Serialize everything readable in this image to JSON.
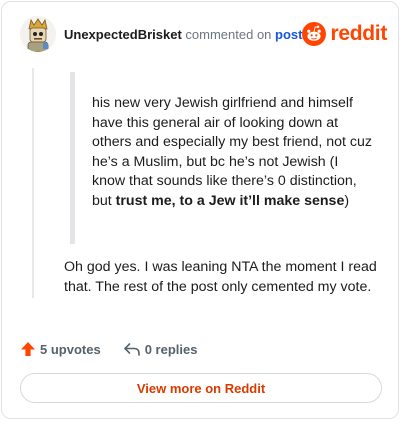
{
  "header": {
    "username": "UnexpectedBrisket",
    "action_text": "commented on",
    "post_link": "post",
    "brand_name": "reddit"
  },
  "comment": {
    "quote_part1": "his new very Jewish girlfriend and himself have this general air of looking down at others and especially my best friend, not cuz he’s a Muslim, but bc he’s not Jewish (I know that sounds like there’s 0 distinction, but ",
    "quote_bold": "trust me, to a Jew it’ll make sense",
    "quote_part3": ")",
    "reply_text": "Oh god yes. I was leaning NTA the moment I read that. The rest of the post only cemented my vote."
  },
  "footer": {
    "upvotes_label": "5 upvotes",
    "replies_label": "0 replies",
    "view_more_label": "View more on Reddit"
  },
  "icons": {
    "upvote": "upvote-arrow-icon",
    "reply": "reply-arrow-icon",
    "brand": "reddit-snoo-icon",
    "avatar": "avatar-character"
  },
  "colors": {
    "brand_orange": "#ff4500",
    "link_blue": "#1a56d6",
    "view_more_text": "#d93a00"
  }
}
